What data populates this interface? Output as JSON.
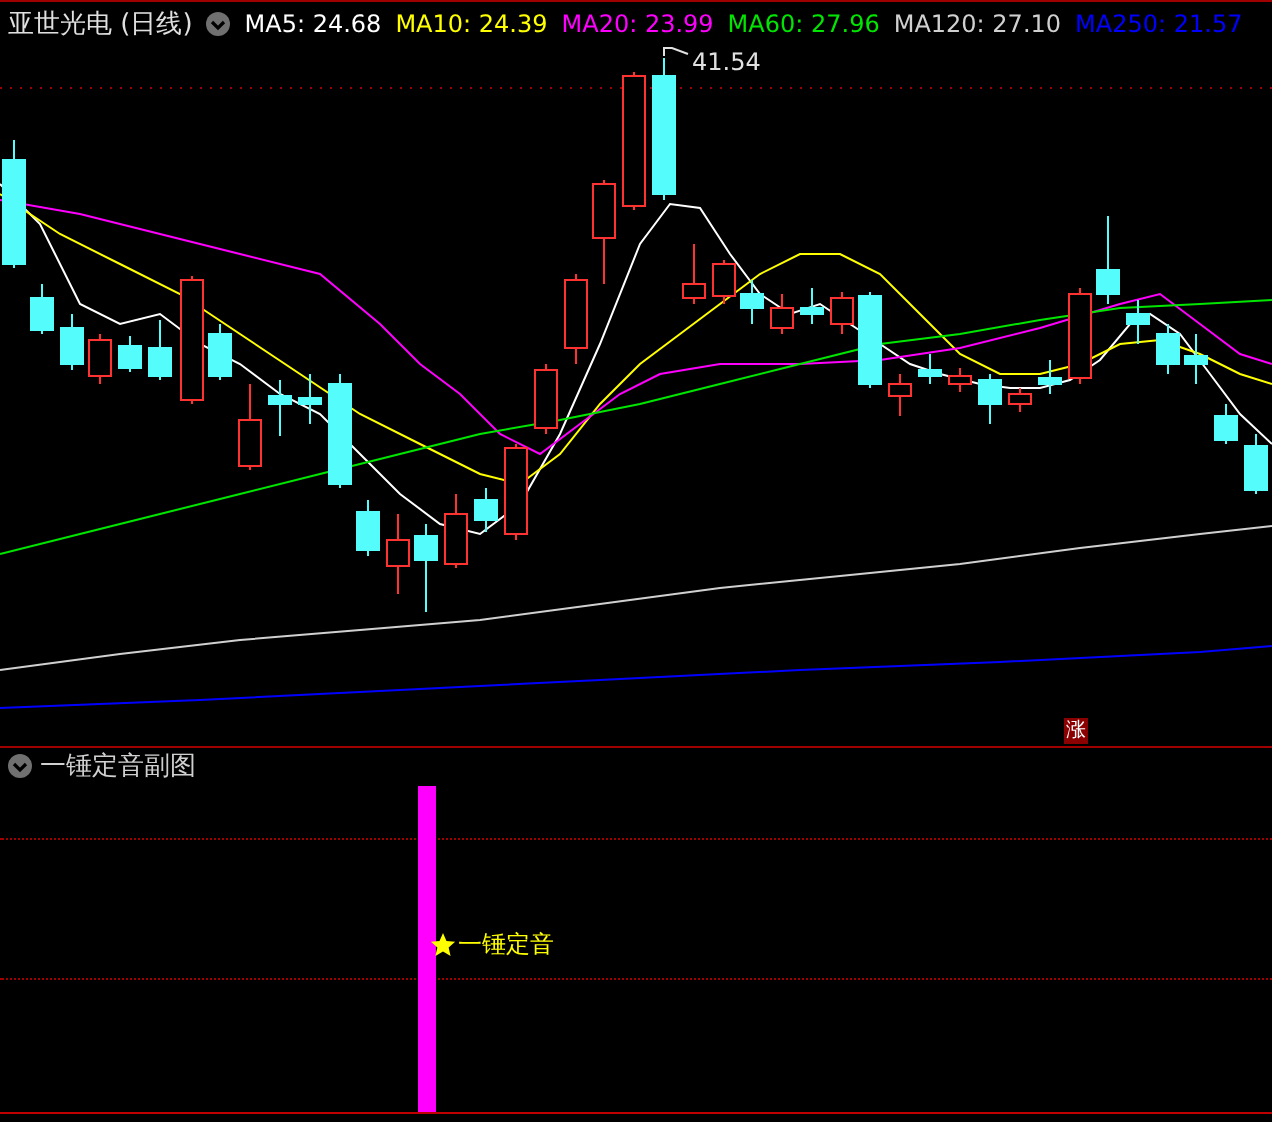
{
  "header": {
    "title": "亚世光电 (日线)",
    "ma": [
      {
        "text": "MA5: 24.68",
        "color": "#ffffff"
      },
      {
        "text": "MA10: 24.39",
        "color": "#ffff00"
      },
      {
        "text": "MA20: 23.99",
        "color": "#ff00ff"
      },
      {
        "text": "MA60: 27.96",
        "color": "#00e600"
      },
      {
        "text": "MA120: 27.10",
        "color": "#d0d0d0"
      },
      {
        "text": "MA250: 21.57",
        "color": "#0000ff"
      }
    ]
  },
  "main_chart": {
    "peak_label": "41.54",
    "badge": "涨"
  },
  "sub_chart": {
    "title": "一锤定音副图",
    "signal_label": "一锤定音"
  }
}
